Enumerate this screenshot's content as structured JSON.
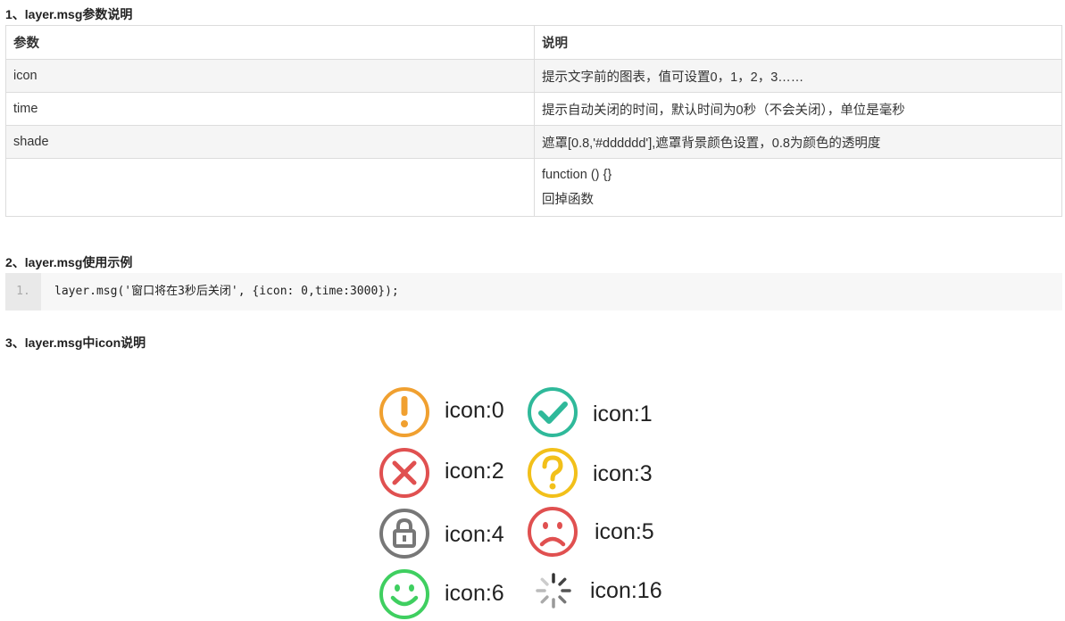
{
  "sections": {
    "s1_title": "1、layer.msg参数说明",
    "s2_title": "2、layer.msg使用示例",
    "s3_title": "3、layer.msg中icon说明"
  },
  "table": {
    "headers": [
      "参数",
      "说明"
    ],
    "rows": [
      {
        "param": "icon",
        "desc": "提示文字前的图表，值可设置0，1，2，3……"
      },
      {
        "param": "time",
        "desc": "提示自动关闭的时间，默认时间为0秒（不会关闭），单位是毫秒"
      },
      {
        "param": "shade",
        "desc": "遮罩[0.8,'#dddddd'],遮罩背景颜色设置，0.8为颜色的透明度"
      },
      {
        "param": "",
        "desc_line1": "function () {}",
        "desc_line2": "回掉函数"
      }
    ]
  },
  "code": {
    "line_number": "1.",
    "text": "layer.msg('窗口将在3秒后关闭', {icon: 0,time:3000});"
  },
  "icons": [
    {
      "label": "icon:0",
      "icon": "exclamation-icon",
      "color": "#f0a030"
    },
    {
      "label": "icon:1",
      "icon": "check-icon",
      "color": "#2fb99a"
    },
    {
      "label": "icon:2",
      "icon": "x-icon",
      "color": "#e05050"
    },
    {
      "label": "icon:3",
      "icon": "question-icon",
      "color": "#f2c01a"
    },
    {
      "label": "icon:4",
      "icon": "lock-icon",
      "color": "#777777"
    },
    {
      "label": "icon:5",
      "icon": "sad-face-icon",
      "color": "#e05050"
    },
    {
      "label": "icon:6",
      "icon": "smile-face-icon",
      "color": "#3fcf60"
    },
    {
      "label": "icon:16",
      "icon": "loading-spinner-icon",
      "color": "#999999"
    }
  ]
}
